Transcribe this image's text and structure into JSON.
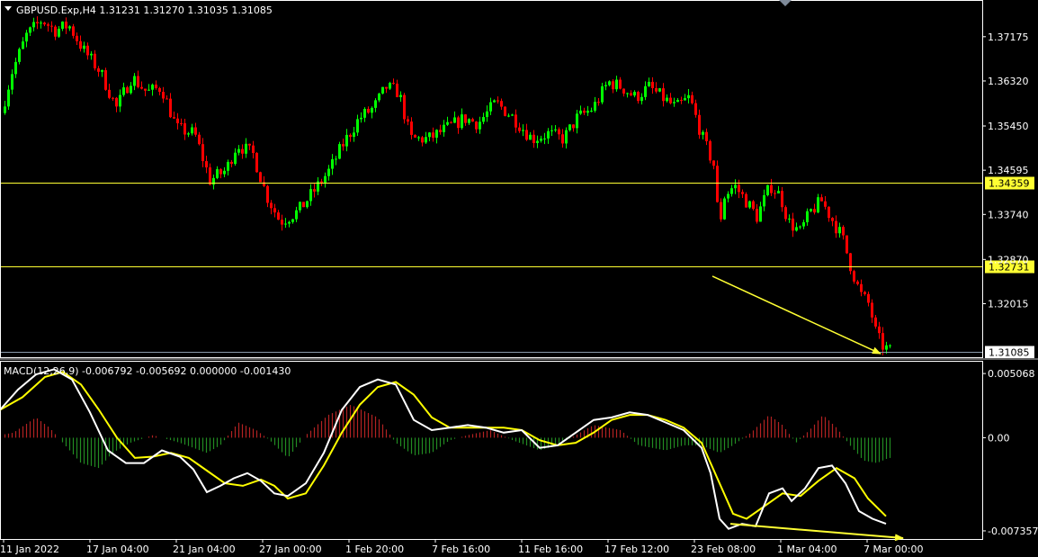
{
  "main_title": "GBPUSD.Exp,H4  1.31231 1.31270 1.31035 1.31085",
  "macd_title": "MACD(12,26,9) -0.006792 -0.005692 0.000000 -0.001430",
  "colors": {
    "background": "#000000",
    "bull": "#00ff00",
    "bear": "#ff0000",
    "hline": "#ffff33",
    "signal": "#ffff00",
    "macd": "#ffffff",
    "hist_pos": "#b22222",
    "hist_neg": "#228b22",
    "arrow": "#ffff33",
    "axis": "#ffffff"
  },
  "chart_data": [
    {
      "type": "candlestick",
      "symbol": "GBPUSD.Exp",
      "timeframe": "H4",
      "last_bar": {
        "open": 1.31231,
        "high": 1.3127,
        "low": 1.31035,
        "close": 1.31085
      },
      "ylim": [
        1.3098,
        1.3785
      ],
      "y_ticks": [
        "1.37175",
        "1.36320",
        "1.35450",
        "1.34595",
        "1.33740",
        "1.32870",
        "1.32015"
      ],
      "y_tick_values": [
        1.37175,
        1.3632,
        1.3545,
        1.34595,
        1.3374,
        1.3287,
        1.32015
      ],
      "x_ticks": [
        "11 Jan 2022",
        "17 Jan 04:00",
        "21 Jan 04:00",
        "27 Jan 00:00",
        "1 Feb 20:00",
        "7 Feb 16:00",
        "11 Feb 16:00",
        "17 Feb 12:00",
        "23 Feb 08:00",
        "1 Mar 04:00",
        "7 Mar 00:00"
      ],
      "horizontal_levels": [
        {
          "value": 1.34359,
          "label": "1.34359"
        },
        {
          "value": 1.32731,
          "label": "1.32731"
        }
      ],
      "current_price": {
        "value": 1.31085,
        "label": "1.31085"
      },
      "close_path": [
        [
          0,
          1.357
        ],
        [
          12,
          1.365
        ],
        [
          28,
          1.372
        ],
        [
          45,
          1.375
        ],
        [
          60,
          1.373
        ],
        [
          75,
          1.374
        ],
        [
          92,
          1.369
        ],
        [
          110,
          1.365
        ],
        [
          128,
          1.358
        ],
        [
          145,
          1.364
        ],
        [
          162,
          1.361
        ],
        [
          178,
          1.362
        ],
        [
          195,
          1.354
        ],
        [
          215,
          1.353
        ],
        [
          232,
          1.344
        ],
        [
          250,
          1.346
        ],
        [
          262,
          1.351
        ],
        [
          280,
          1.349
        ],
        [
          295,
          1.341
        ],
        [
          310,
          1.336
        ],
        [
          330,
          1.338
        ],
        [
          348,
          1.342
        ],
        [
          365,
          1.346
        ],
        [
          380,
          1.351
        ],
        [
          398,
          1.356
        ],
        [
          414,
          1.358
        ],
        [
          428,
          1.362
        ],
        [
          442,
          1.361
        ],
        [
          455,
          1.352
        ],
        [
          475,
          1.352
        ],
        [
          495,
          1.354
        ],
        [
          515,
          1.356
        ],
        [
          530,
          1.355
        ],
        [
          550,
          1.359
        ],
        [
          570,
          1.356
        ],
        [
          590,
          1.352
        ],
        [
          608,
          1.353
        ],
        [
          625,
          1.352
        ],
        [
          640,
          1.356
        ],
        [
          658,
          1.358
        ],
        [
          675,
          1.363
        ],
        [
          690,
          1.362
        ],
        [
          705,
          1.36
        ],
        [
          720,
          1.362
        ],
        [
          735,
          1.36
        ],
        [
          750,
          1.358
        ],
        [
          765,
          1.36
        ],
        [
          780,
          1.352
        ],
        [
          792,
          1.347
        ],
        [
          798,
          1.335
        ],
        [
          804,
          1.341
        ],
        [
          815,
          1.343
        ],
        [
          828,
          1.34
        ],
        [
          840,
          1.337
        ],
        [
          855,
          1.343
        ],
        [
          866,
          1.341
        ],
        [
          875,
          1.336
        ],
        [
          888,
          1.334
        ],
        [
          900,
          1.338
        ],
        [
          912,
          1.34
        ],
        [
          925,
          1.336
        ],
        [
          935,
          1.333
        ],
        [
          945,
          1.327
        ],
        [
          955,
          1.322
        ],
        [
          965,
          1.32
        ],
        [
          973,
          1.314
        ],
        [
          980,
          1.312
        ],
        [
          988,
          1.311
        ]
      ],
      "annotations": [
        {
          "type": "arrow",
          "from": [
            "23 Feb 08:00",
            1.3265
          ],
          "to": [
            "7 Mar 00:00",
            1.311
          ]
        }
      ]
    },
    {
      "type": "macd",
      "indicator": "MACD(12,26,9)",
      "values": {
        "macd": -0.006792,
        "signal": -0.005692,
        "level": 0.0,
        "histogram": -0.00143
      },
      "ylim": [
        -0.008,
        0.006
      ],
      "y_ticks": [
        "0.005068",
        "0.00",
        "-0.007357"
      ],
      "y_tick_values": [
        0.005068,
        0.0,
        -0.007357
      ],
      "series": [
        {
          "name": "MACD",
          "values": [
            [
              0,
              0.0022
            ],
            [
              20,
              0.0038
            ],
            [
              40,
              0.005
            ],
            [
              60,
              0.0054
            ],
            [
              80,
              0.0046
            ],
            [
              100,
              0.002
            ],
            [
              120,
              -0.001
            ],
            [
              140,
              -0.002
            ],
            [
              160,
              -0.002
            ],
            [
              180,
              -0.001
            ],
            [
              200,
              -0.0015
            ],
            [
              215,
              -0.0025
            ],
            [
              230,
              -0.0043
            ],
            [
              245,
              -0.0038
            ],
            [
              260,
              -0.0032
            ],
            [
              275,
              -0.0028
            ],
            [
              290,
              -0.0034
            ],
            [
              305,
              -0.0044
            ],
            [
              320,
              -0.0046
            ],
            [
              340,
              -0.0036
            ],
            [
              360,
              -0.0012
            ],
            [
              380,
              0.0022
            ],
            [
              400,
              0.004
            ],
            [
              420,
              0.0046
            ],
            [
              440,
              0.0042
            ],
            [
              460,
              0.0014
            ],
            [
              480,
              0.0006
            ],
            [
              500,
              0.0008
            ],
            [
              520,
              0.001
            ],
            [
              540,
              0.0008
            ],
            [
              560,
              0.0004
            ],
            [
              580,
              0.0006
            ],
            [
              600,
              -0.0008
            ],
            [
              620,
              -0.0006
            ],
            [
              640,
              0.0004
            ],
            [
              660,
              0.0014
            ],
            [
              680,
              0.0016
            ],
            [
              700,
              0.002
            ],
            [
              720,
              0.0018
            ],
            [
              740,
              0.0012
            ],
            [
              760,
              0.0006
            ],
            [
              780,
              -0.0008
            ],
            [
              790,
              -0.0028
            ],
            [
              800,
              -0.0064
            ],
            [
              810,
              -0.0072
            ],
            [
              825,
              -0.0068
            ],
            [
              840,
              -0.007
            ],
            [
              855,
              -0.0044
            ],
            [
              870,
              -0.004
            ],
            [
              880,
              -0.005
            ],
            [
              895,
              -0.004
            ],
            [
              910,
              -0.0024
            ],
            [
              925,
              -0.0022
            ],
            [
              940,
              -0.0036
            ],
            [
              955,
              -0.0058
            ],
            [
              970,
              -0.0064
            ],
            [
              985,
              -0.0068
            ]
          ]
        },
        {
          "name": "Signal",
          "values": [
            [
              0,
              0.0022
            ],
            [
              25,
              0.0032
            ],
            [
              50,
              0.0048
            ],
            [
              70,
              0.0052
            ],
            [
              90,
              0.0042
            ],
            [
              110,
              0.0022
            ],
            [
              130,
              0.0
            ],
            [
              150,
              -0.0016
            ],
            [
              170,
              -0.0015
            ],
            [
              190,
              -0.0012
            ],
            [
              210,
              -0.0016
            ],
            [
              230,
              -0.0026
            ],
            [
              250,
              -0.0036
            ],
            [
              270,
              -0.0038
            ],
            [
              290,
              -0.0033
            ],
            [
              305,
              -0.0038
            ],
            [
              320,
              -0.0048
            ],
            [
              340,
              -0.0044
            ],
            [
              360,
              -0.0022
            ],
            [
              380,
              0.0004
            ],
            [
              400,
              0.0026
            ],
            [
              420,
              0.004
            ],
            [
              440,
              0.0044
            ],
            [
              460,
              0.0034
            ],
            [
              480,
              0.0016
            ],
            [
              500,
              0.0008
            ],
            [
              520,
              0.0008
            ],
            [
              540,
              0.0008
            ],
            [
              560,
              0.0008
            ],
            [
              580,
              0.0006
            ],
            [
              600,
              -0.0002
            ],
            [
              620,
              -0.0006
            ],
            [
              640,
              -0.0004
            ],
            [
              660,
              0.0004
            ],
            [
              680,
              0.0014
            ],
            [
              700,
              0.0018
            ],
            [
              720,
              0.0018
            ],
            [
              740,
              0.0014
            ],
            [
              760,
              0.0008
            ],
            [
              780,
              -0.0004
            ],
            [
              800,
              -0.0036
            ],
            [
              815,
              -0.006
            ],
            [
              830,
              -0.0064
            ],
            [
              850,
              -0.0054
            ],
            [
              870,
              -0.0044
            ],
            [
              890,
              -0.0046
            ],
            [
              910,
              -0.0034
            ],
            [
              930,
              -0.0024
            ],
            [
              950,
              -0.0032
            ],
            [
              965,
              -0.0048
            ],
            [
              985,
              -0.0062
            ]
          ]
        }
      ],
      "histogram_profile": [
        [
          0,
          0.0002
        ],
        [
          15,
          0.0004
        ],
        [
          40,
          0.0016
        ],
        [
          55,
          0.0008
        ],
        [
          70,
          -0.0004
        ],
        [
          90,
          -0.002
        ],
        [
          110,
          -0.0024
        ],
        [
          125,
          -0.0012
        ],
        [
          145,
          -0.0004
        ],
        [
          170,
          0.0002
        ],
        [
          200,
          -0.0004
        ],
        [
          230,
          -0.0012
        ],
        [
          245,
          -0.0006
        ],
        [
          265,
          0.0012
        ],
        [
          285,
          0.0006
        ],
        [
          300,
          -0.0002
        ],
        [
          320,
          -0.0016
        ],
        [
          340,
          0.0002
        ],
        [
          365,
          0.0018
        ],
        [
          390,
          0.0026
        ],
        [
          420,
          0.0016
        ],
        [
          440,
          -0.0004
        ],
        [
          460,
          -0.0014
        ],
        [
          480,
          -0.0012
        ],
        [
          500,
          -0.0002
        ],
        [
          520,
          0.0002
        ],
        [
          545,
          0.0006
        ],
        [
          570,
          -0.0002
        ],
        [
          600,
          -0.001
        ],
        [
          620,
          -0.0006
        ],
        [
          640,
          0.0002
        ],
        [
          660,
          0.001
        ],
        [
          690,
          0.0006
        ],
        [
          710,
          -0.0006
        ],
        [
          740,
          -0.001
        ],
        [
          760,
          -0.0006
        ],
        [
          780,
          -0.0006
        ],
        [
          800,
          -0.0012
        ],
        [
          815,
          -0.0006
        ],
        [
          835,
          0.0004
        ],
        [
          855,
          0.0018
        ],
        [
          870,
          0.001
        ],
        [
          885,
          -0.0004
        ],
        [
          900,
          0.0006
        ],
        [
          915,
          0.0018
        ],
        [
          930,
          0.0008
        ],
        [
          945,
          -0.0006
        ],
        [
          960,
          -0.0018
        ],
        [
          975,
          -0.002
        ],
        [
          988,
          -0.0016
        ]
      ],
      "annotations": [
        {
          "type": "arrow",
          "from": [
            "23 Feb 08:00",
            -0.0068
          ],
          "to": [
            "7 Mar 00:00",
            -0.008
          ]
        }
      ]
    }
  ]
}
